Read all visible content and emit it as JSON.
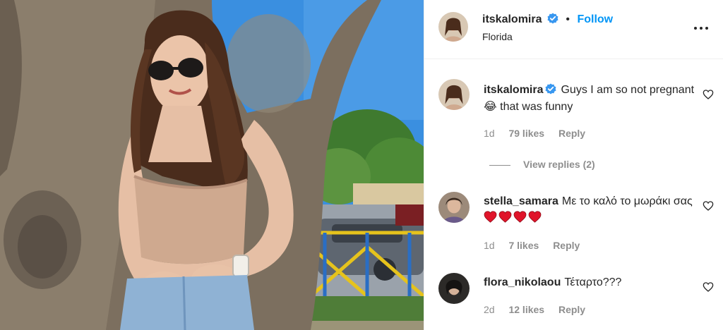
{
  "post": {
    "author": "itskalomira",
    "follow_label": "Follow",
    "location": "Florida",
    "separator": "•"
  },
  "comments": [
    {
      "username": "itskalomira",
      "verified": true,
      "text": "Guys I am so not pregnant 😂 that was funny",
      "age": "1d",
      "likes": "79 likes",
      "reply_label": "Reply",
      "view_replies": "View replies (2)"
    },
    {
      "username": "stella_samara",
      "verified": false,
      "text": "Με το καλό το μωράκι σας",
      "hearts": 4,
      "age": "1d",
      "likes": "7 likes",
      "reply_label": "Reply"
    },
    {
      "username": "flora_nikolaou",
      "verified": false,
      "text": "Τέταρτο???",
      "age": "2d",
      "likes": "12 likes",
      "reply_label": "Reply"
    }
  ],
  "icons": {
    "verified": "verified-badge-icon",
    "more": "more-options-icon",
    "like": "heart-outline-icon",
    "emoji_laugh": "😂",
    "emoji_heart": "red-heart-icon"
  },
  "colors": {
    "link": "#0095f6",
    "verified": "#3897f0",
    "muted": "#8e8e8e",
    "heart_red": "#e0142a"
  }
}
